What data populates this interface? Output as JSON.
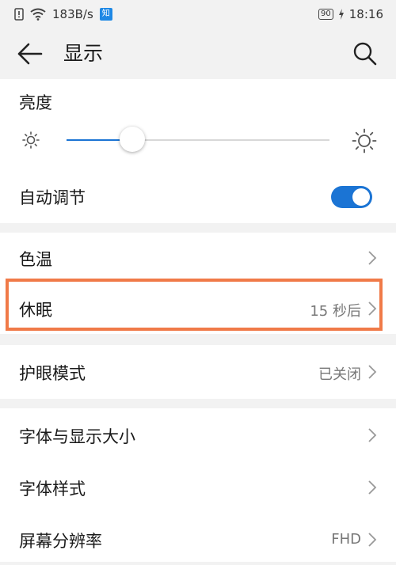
{
  "status_bar": {
    "network_speed": "183B/s",
    "app_badge": "知",
    "battery": "90",
    "time": "18:16"
  },
  "header": {
    "title": "显示"
  },
  "brightness": {
    "label": "亮度",
    "level": 0.25
  },
  "auto_adjust": {
    "label": "自动调节",
    "enabled": true
  },
  "rows": {
    "color_temp": {
      "label": "色温"
    },
    "sleep": {
      "label": "休眠",
      "value": "15 秒后"
    },
    "eye_comfort": {
      "label": "护眼模式",
      "value": "已关闭"
    },
    "font_display_size": {
      "label": "字体与显示大小"
    },
    "font_style": {
      "label": "字体样式"
    },
    "resolution": {
      "label": "屏幕分辨率",
      "value": "FHD"
    }
  },
  "colors": {
    "accent": "#1b74d4",
    "highlight_border": "#f07a48",
    "background": "#f2f2f2"
  }
}
